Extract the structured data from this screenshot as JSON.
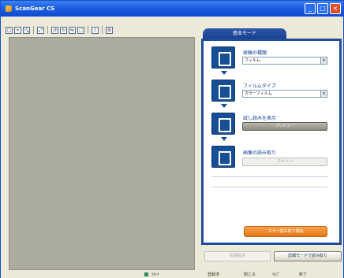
{
  "window": {
    "title": "ScanGear CS",
    "title_buttons": [
      "minimize-icon",
      "maximize-icon",
      "close-icon"
    ]
  },
  "toolbar": {
    "icons": [
      "crop-icon",
      "select-icon",
      "zoom-icon",
      "fit-icon",
      "rotate-left-icon",
      "rotate-right-icon",
      "mirror-icon",
      "auto-crop-icon",
      "info-icon",
      "settings-icon"
    ]
  },
  "panel": {
    "tab_label": "基本モード",
    "steps": [
      {
        "label": "原稿の種類",
        "value": "フィルム",
        "icon": "document-type-icon"
      },
      {
        "label": "フィルムタイプ",
        "value": "カラーフィルム",
        "icon": "film-type-icon"
      },
      {
        "label": "試し読みを表示",
        "button": "プレビュー",
        "icon": "preview-icon"
      },
      {
        "label": "画像の読み取り",
        "button": "スキャン",
        "icon": "scan-icon"
      }
    ],
    "scan_button": "カラー読み取り開始"
  },
  "footer": {
    "left_button": "初期設定",
    "right_button": "詳細モードで読み取り"
  },
  "status": {
    "items": [
      "ｽｷｬﾅ",
      "登録済",
      "閉じる",
      "ﾍﾙﾌﾟ",
      "終了"
    ]
  }
}
